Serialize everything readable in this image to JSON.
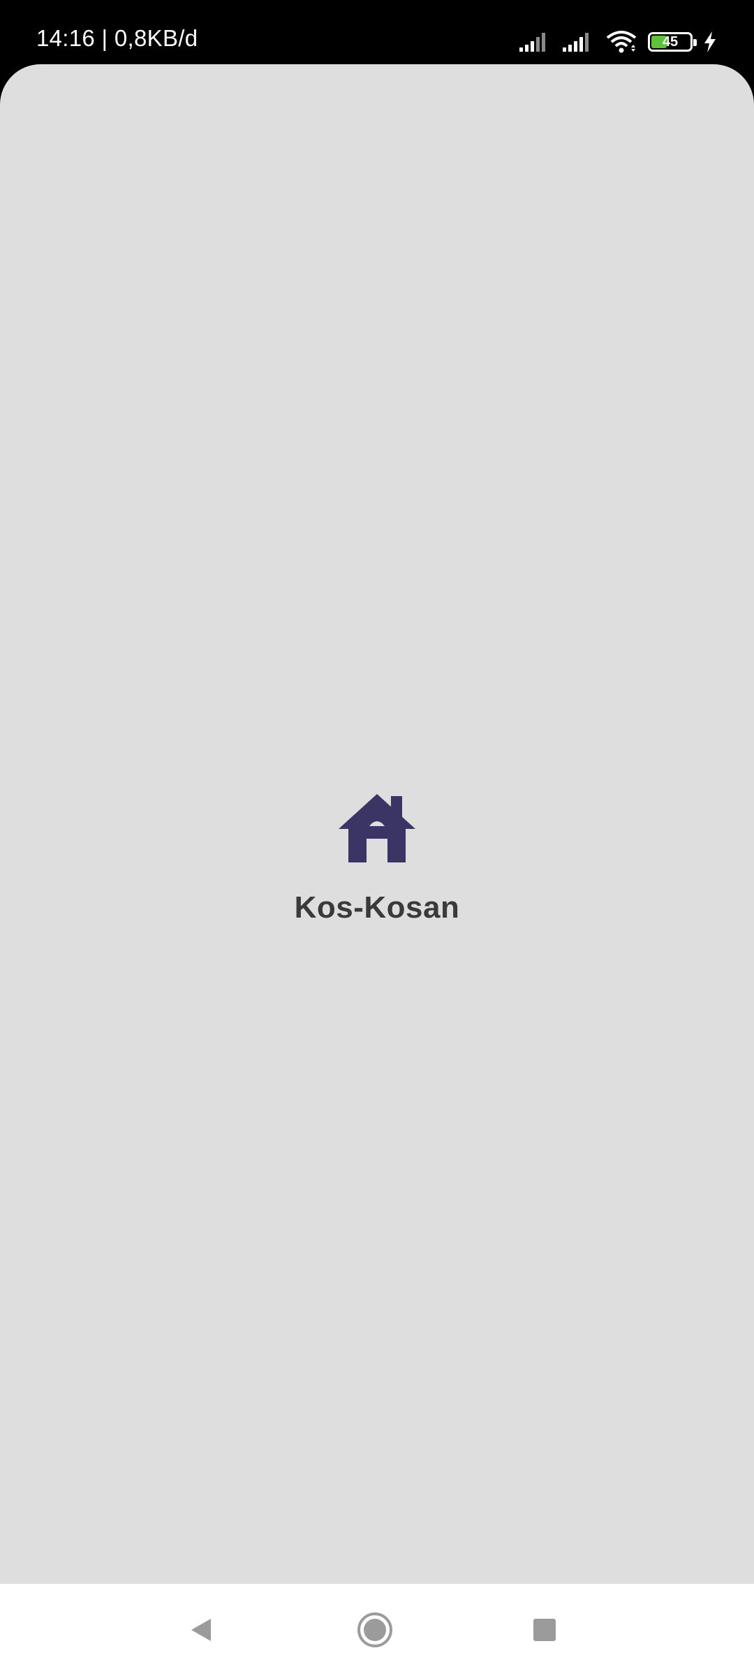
{
  "status_bar": {
    "time_and_speed": "14:16 | 0,8KB/d",
    "battery_level": "45",
    "battery_fraction": 0.45,
    "icons": [
      "signal-icon",
      "signal-icon",
      "wifi-icon",
      "battery-icon",
      "charging-icon"
    ]
  },
  "splash": {
    "icon": "house-icon",
    "title": "Kos-Kosan",
    "colors": {
      "icon": "#3a3564",
      "title": "#3a3a3a",
      "background": "#dedede"
    }
  },
  "nav_bar": {
    "buttons": [
      "back-icon",
      "home-icon",
      "recents-icon"
    ]
  }
}
